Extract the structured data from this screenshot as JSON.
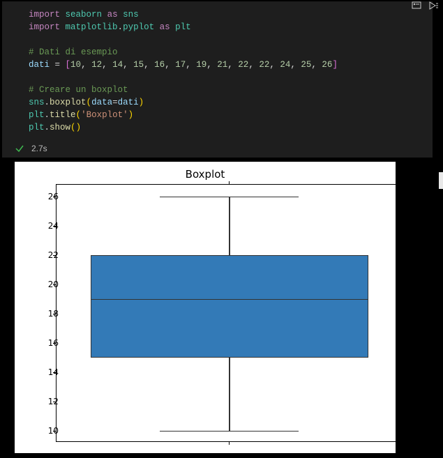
{
  "toolbar": {
    "clear_icon": "clear-outputs-icon",
    "run_icon": "run-by-line-icon"
  },
  "code": {
    "l1_import": "import",
    "l1_mod": "seaborn",
    "l1_as": "as",
    "l1_alias": "sns",
    "l2_import": "import",
    "l2_mod": "matplotlib",
    "l2_dot": ".",
    "l2_sub": "pyplot",
    "l2_as": "as",
    "l2_alias": "plt",
    "l4_com": "# Dati di esempio",
    "l5_var": "dati",
    "l5_eq": " = ",
    "l7_com": "# Creare un boxplot",
    "l8_sns": "sns",
    "l8_dot": ".",
    "l8_boxplot": "boxplot",
    "l8_param": "data",
    "l8_eq": "=",
    "l8_arg": "dati",
    "l9_plt": "plt",
    "l9_dot": ".",
    "l9_title": "title",
    "l9_str": "'Boxplot'",
    "l10_plt": "plt",
    "l10_dot": ".",
    "l10_show": "show",
    "n0": "10",
    "n1": "12",
    "n2": "14",
    "n3": "15",
    "n4": "16",
    "n5": "17",
    "n6": "19",
    "n7": "21",
    "n8": "22",
    "n9": "22",
    "n10": "24",
    "n11": "25",
    "n12": "26"
  },
  "status": {
    "time": "2.7s"
  },
  "chart_data": {
    "type": "boxplot",
    "title": "Boxplot",
    "data": [
      10,
      12,
      14,
      15,
      16,
      17,
      19,
      21,
      22,
      22,
      24,
      25,
      26
    ],
    "min": 10,
    "q1": 15,
    "median": 19,
    "q3": 22,
    "max": 26,
    "yticks": [
      10,
      12,
      14,
      16,
      18,
      20,
      22,
      24,
      26
    ],
    "ylim": [
      9.2,
      26.8
    ],
    "xlabel": "",
    "ylabel": ""
  },
  "ylabels": {
    "t26": "26",
    "t24": "24",
    "t22": "22",
    "t20": "20",
    "t18": "18",
    "t16": "16",
    "t14": "14",
    "t12": "12",
    "t10": "10"
  }
}
